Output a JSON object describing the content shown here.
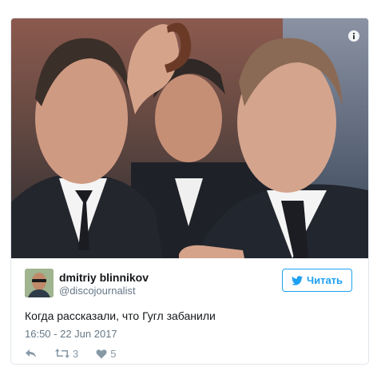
{
  "tweet": {
    "user": {
      "display_name": "dmitriy blinnikov",
      "handle": "@discojournalist"
    },
    "follow_button": {
      "label": "Читать",
      "icon": "twitter-bird-icon"
    },
    "text": "Когда рассказали, что Гугл забанили",
    "timestamp": "16:50 - 22 Jun 2017",
    "actions": {
      "reply": {
        "icon": "reply-icon"
      },
      "retweet": {
        "icon": "retweet-icon",
        "count": "3"
      },
      "like": {
        "icon": "heart-icon",
        "count": "5"
      }
    },
    "media": {
      "info_icon": "info-icon"
    }
  },
  "colors": {
    "accent": "#1da1f2",
    "muted": "#657786",
    "icon": "#8899a6",
    "border": "#e1e8ed"
  }
}
